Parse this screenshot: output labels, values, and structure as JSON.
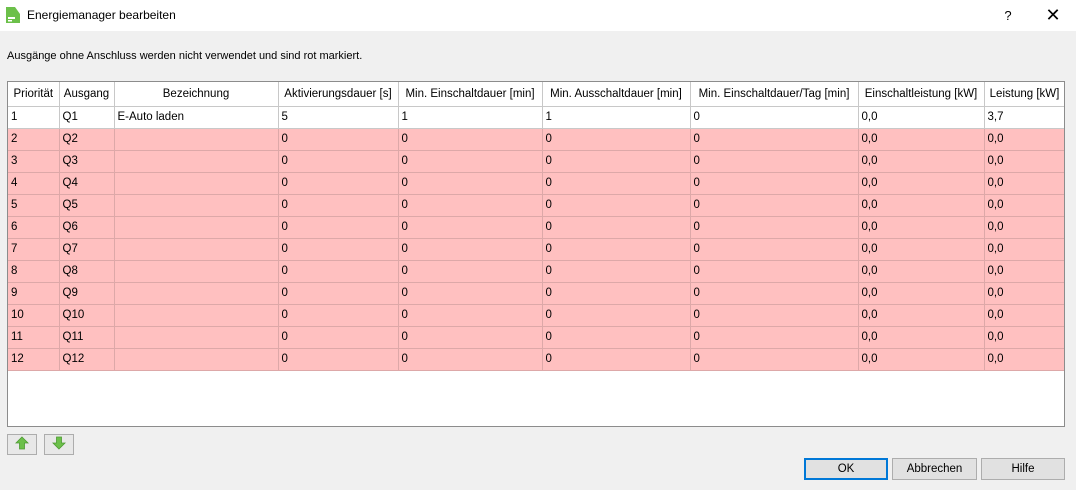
{
  "window": {
    "title": "Energiemanager bearbeiten",
    "help": "?",
    "close": "✕"
  },
  "hint": "Ausgänge ohne Anschluss werden nicht verwendet und sind rot markiert.",
  "table": {
    "columns": [
      "Priorität",
      "Ausgang",
      "Bezeichnung",
      "Aktivierungsdauer [s]",
      "Min. Einschaltdauer [min]",
      "Min. Ausschaltdauer [min]",
      "Min. Einschaltdauer/Tag [min]",
      "Einschaltleistung [kW]",
      "Leistung [kW]"
    ],
    "rows": [
      {
        "state": "ok",
        "cells": [
          "1",
          "Q1",
          "E-Auto laden",
          "5",
          "1",
          "1",
          "0",
          "0,0",
          "3,7"
        ]
      },
      {
        "state": "unused",
        "cells": [
          "2",
          "Q2",
          "",
          "0",
          "0",
          "0",
          "0",
          "0,0",
          "0,0"
        ]
      },
      {
        "state": "unused",
        "cells": [
          "3",
          "Q3",
          "",
          "0",
          "0",
          "0",
          "0",
          "0,0",
          "0,0"
        ]
      },
      {
        "state": "unused",
        "cells": [
          "4",
          "Q4",
          "",
          "0",
          "0",
          "0",
          "0",
          "0,0",
          "0,0"
        ]
      },
      {
        "state": "unused",
        "cells": [
          "5",
          "Q5",
          "",
          "0",
          "0",
          "0",
          "0",
          "0,0",
          "0,0"
        ]
      },
      {
        "state": "unused",
        "cells": [
          "6",
          "Q6",
          "",
          "0",
          "0",
          "0",
          "0",
          "0,0",
          "0,0"
        ]
      },
      {
        "state": "unused",
        "cells": [
          "7",
          "Q7",
          "",
          "0",
          "0",
          "0",
          "0",
          "0,0",
          "0,0"
        ]
      },
      {
        "state": "unused",
        "cells": [
          "8",
          "Q8",
          "",
          "0",
          "0",
          "0",
          "0",
          "0,0",
          "0,0"
        ]
      },
      {
        "state": "unused",
        "cells": [
          "9",
          "Q9",
          "",
          "0",
          "0",
          "0",
          "0",
          "0,0",
          "0,0"
        ]
      },
      {
        "state": "unused",
        "cells": [
          "10",
          "Q10",
          "",
          "0",
          "0",
          "0",
          "0",
          "0,0",
          "0,0"
        ]
      },
      {
        "state": "unused",
        "cells": [
          "11",
          "Q11",
          "",
          "0",
          "0",
          "0",
          "0",
          "0,0",
          "0,0"
        ]
      },
      {
        "state": "unused",
        "cells": [
          "12",
          "Q12",
          "",
          "0",
          "0",
          "0",
          "0",
          "0,0",
          "0,0"
        ]
      }
    ]
  },
  "colors": {
    "unused_row": "#ffc0c0",
    "arrow": "#6cc04a",
    "accent": "#0078d7"
  },
  "icons": {
    "move_up": "arrow-up-icon",
    "move_down": "arrow-down-icon",
    "app": "energy-manager-icon"
  },
  "buttons": {
    "ok": "OK",
    "cancel": "Abbrechen",
    "help": "Hilfe"
  }
}
